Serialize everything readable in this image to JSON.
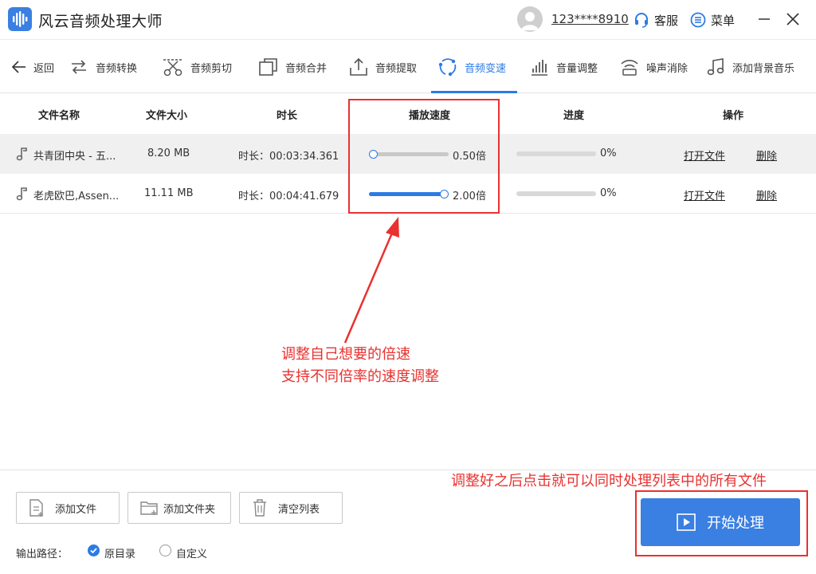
{
  "app": {
    "title": "风云音频处理大师"
  },
  "account": {
    "username": "123****8910",
    "service_label": "客服",
    "menu_label": "菜单"
  },
  "toolbar": {
    "back_label": "返回",
    "tools": [
      {
        "label": "音频转换",
        "icon": "convert-icon"
      },
      {
        "label": "音频剪切",
        "icon": "scissors-icon"
      },
      {
        "label": "音频合并",
        "icon": "merge-icon"
      },
      {
        "label": "音频提取",
        "icon": "extract-icon"
      },
      {
        "label": "音频变速",
        "icon": "speed-icon",
        "active": true
      },
      {
        "label": "音量调整",
        "icon": "volume-bars-icon"
      },
      {
        "label": "噪声消除",
        "icon": "noise-icon"
      },
      {
        "label": "添加背景音乐",
        "icon": "music-note-icon"
      }
    ],
    "accent": "#2c7be5"
  },
  "table": {
    "headers": {
      "name": "文件名称",
      "size": "文件大小",
      "duration": "时长",
      "speed": "播放速度",
      "progress": "进度",
      "actions": "操作"
    },
    "rows": [
      {
        "name": "共青团中央 - 五...",
        "size": "8.20 MB",
        "duration": "时长：00:03:34.361",
        "speed_label": "0.50倍",
        "speed_level": 0,
        "progress": "0%",
        "progress_value": 0,
        "open_label": "打开文件",
        "delete_label": "删除"
      },
      {
        "name": "老虎欧巴,Assen...",
        "size": "11.11 MB",
        "duration": "时长：00:04:41.679",
        "speed_label": "2.00倍",
        "speed_level": 1,
        "progress": "0%",
        "progress_value": 0,
        "open_label": "打开文件",
        "delete_label": "删除"
      }
    ]
  },
  "annotations": {
    "speed_note_line1": "调整自己想要的倍速",
    "speed_note_line2": "支持不同倍率的速度调整",
    "start_note": "调整好之后点击就可以同时处理列表中的所有文件",
    "color": "#e8322f"
  },
  "bottom": {
    "add_file": "添加文件",
    "add_folder": "添加文件夹",
    "clear_list": "清空列表",
    "output_label": "输出路径：",
    "opt_original": "原目录",
    "opt_custom": "自定义",
    "selected": "原目录",
    "start_label": "开始处理"
  }
}
